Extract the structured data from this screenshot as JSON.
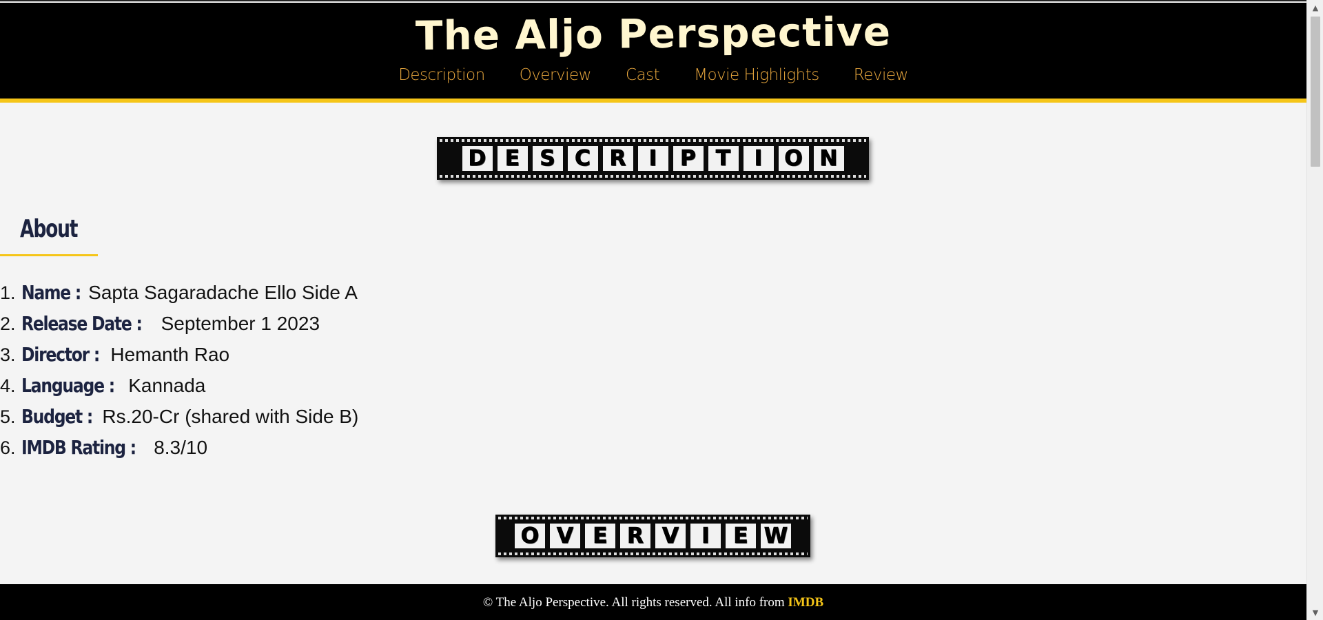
{
  "site": {
    "title": "The Aljo Perspective"
  },
  "nav": {
    "items": [
      {
        "label": "Description"
      },
      {
        "label": "Overview"
      },
      {
        "label": "Cast"
      },
      {
        "label": "Movie Highlights"
      },
      {
        "label": "Review"
      }
    ]
  },
  "sections": {
    "description": {
      "letters": [
        "D",
        "E",
        "S",
        "C",
        "R",
        "I",
        "P",
        "T",
        "I",
        "O",
        "N"
      ]
    },
    "overview": {
      "letters": [
        "O",
        "V",
        "E",
        "R",
        "V",
        "I",
        "E",
        "W"
      ]
    }
  },
  "about": {
    "heading": "About",
    "items": [
      {
        "num": "1.",
        "label": "Name :",
        "value": "Sapta Sagaradache Ello Side A"
      },
      {
        "num": "2.",
        "label": "Release Date :",
        "value": "September 1 2023"
      },
      {
        "num": "3.",
        "label": "Director :",
        "value": "Hemanth Rao"
      },
      {
        "num": "4.",
        "label": "Language :",
        "value": "Kannada"
      },
      {
        "num": "5.",
        "label": "Budget :",
        "value": "Rs.20-Cr (shared with Side B)"
      },
      {
        "num": "6.",
        "label": "IMDB Rating :",
        "value": "8.3/10"
      }
    ]
  },
  "footer": {
    "text": "© The Aljo Perspective. All rights reserved. All info from",
    "link_label": "IMDB"
  },
  "scrollbar": {
    "up_icon": "▲",
    "down_icon": "▼"
  },
  "colors": {
    "header_bg": "#000000",
    "accent": "#f5c518",
    "nav_link": "#e8a73d",
    "title": "#fff6cf",
    "heading_navy": "#1c2340",
    "page_bg": "#f4f4f4"
  }
}
